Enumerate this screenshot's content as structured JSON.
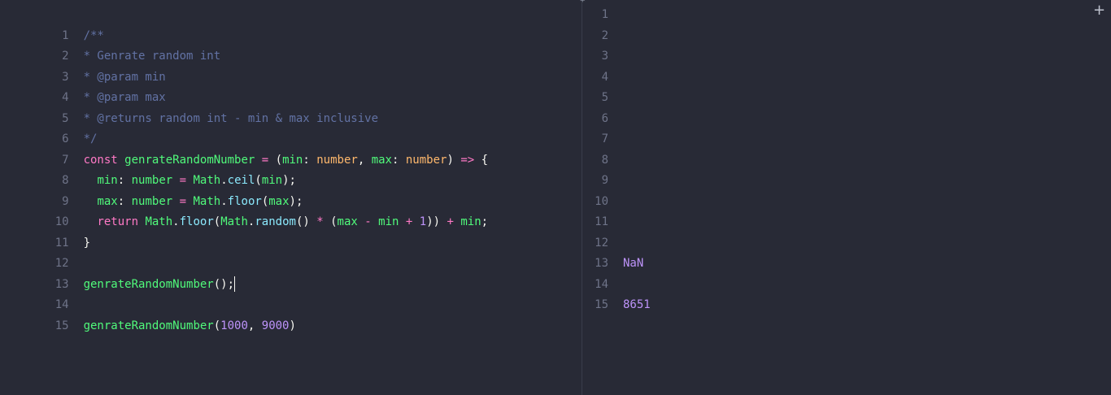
{
  "editor": {
    "line_numbers": [
      "1",
      "2",
      "3",
      "4",
      "5",
      "6",
      "7",
      "8",
      "9",
      "10",
      "11",
      "12",
      "13",
      "14",
      "15"
    ],
    "lines": {
      "l1": "/**",
      "l2": "* Genrate random int",
      "l3": "* @param min",
      "l4": "* @param max",
      "l5": "* @returns random int - min & max inclusive",
      "l6": "*/",
      "l7": {
        "const": "const",
        "name": "genrateRandomNumber",
        "eq": "=",
        "open": "(",
        "p1": "min",
        "colon1": ":",
        "t1": "number",
        "comma": ",",
        "p2": "max",
        "colon2": ":",
        "t2": "number",
        "close": ")",
        "arrow": "=>",
        "brace": "{"
      },
      "l8": {
        "var": "min",
        "colon": ":",
        "type": "number",
        "eq": "=",
        "obj": "Math",
        "dot": ".",
        "meth": "ceil",
        "open": "(",
        "arg": "min",
        "close": ");"
      },
      "l9": {
        "var": "max",
        "colon": ":",
        "type": "number",
        "eq": "=",
        "obj": "Math",
        "dot": ".",
        "meth": "floor",
        "open": "(",
        "arg": "max",
        "close": ");"
      },
      "l10": {
        "ret": "return",
        "obj1": "Math",
        "dot1": ".",
        "meth1": "floor",
        "open1": "(",
        "obj2": "Math",
        "dot2": ".",
        "meth2": "random",
        "call": "()",
        "mul": "*",
        "open2": "(",
        "a": "max",
        "minus": "-",
        "b": "min",
        "plus": "+",
        "one": "1",
        "close": "))",
        "plus2": "+",
        "c": "min",
        "semi": ";"
      },
      "l11": "}",
      "l13": {
        "name": "genrateRandomNumber",
        "call": "();"
      },
      "l15": {
        "name": "genrateRandomNumber",
        "open": "(",
        "a1": "1000",
        "comma": ",",
        "a2": "9000",
        "close": ")"
      }
    }
  },
  "output": {
    "line_numbers": [
      "1",
      "2",
      "3",
      "4",
      "5",
      "6",
      "7",
      "8",
      "9",
      "10",
      "11",
      "12",
      "13",
      "14",
      "15"
    ],
    "results": {
      "r13": "NaN",
      "r15": "8651"
    }
  },
  "toolbar": {
    "add_label": "+",
    "divider_glyph": "✶"
  },
  "colors": {
    "background": "#282a36",
    "comment": "#6272a4",
    "keyword": "#ff79c6",
    "function": "#50fa7b",
    "type": "#ffb86c",
    "number": "#bd93f9",
    "method": "#8be9fd"
  }
}
